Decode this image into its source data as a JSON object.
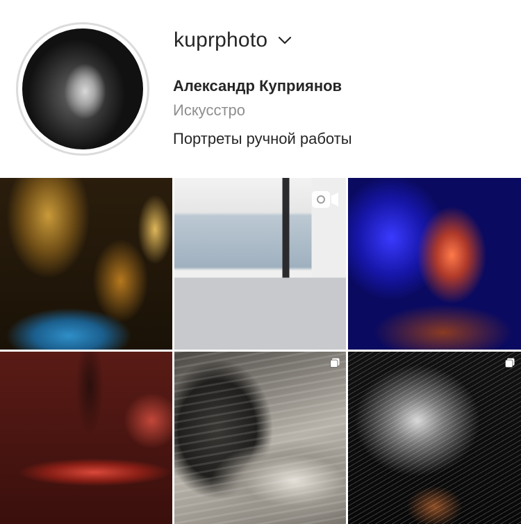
{
  "profile": {
    "username": "kuprphoto",
    "full_name": "Александр Куприянов",
    "category": "Искусстро",
    "bio": "Портреты ручной работы"
  },
  "icons": {
    "username_dropdown": "chevron-down-icon",
    "video_badge": "video-camera-icon",
    "carousel_badge": "multiple-posts-icon"
  },
  "colors": {
    "primary_text": "#262626",
    "secondary_text": "#8e8e8e",
    "avatar_ring": "#dbdbdb"
  },
  "grid": {
    "posts": [
      {
        "badge": ""
      },
      {
        "badge": "video-camera-icon"
      },
      {
        "badge": ""
      },
      {
        "badge": ""
      },
      {
        "badge": "multiple-posts-icon"
      },
      {
        "badge": "multiple-posts-icon"
      }
    ]
  }
}
